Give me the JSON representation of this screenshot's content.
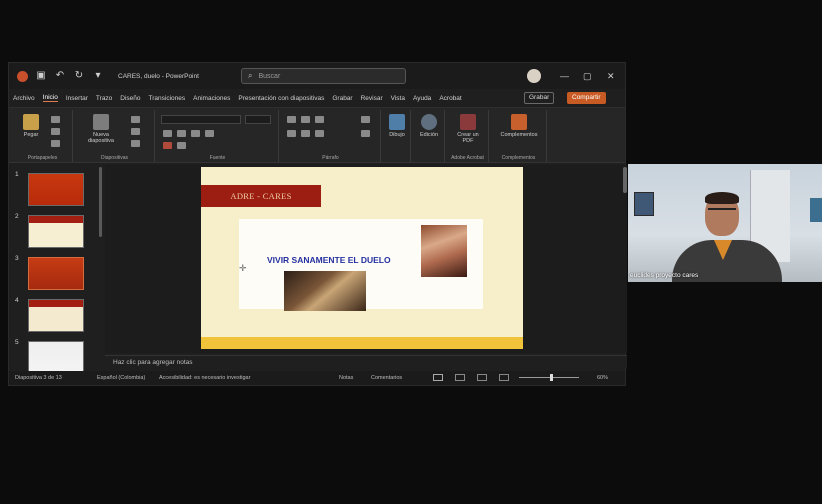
{
  "window": {
    "title": "CARES, duelo  -  PowerPoint",
    "search_placeholder": "Buscar",
    "minimize_glyph": "—",
    "maximize_glyph": "▢",
    "close_glyph": "✕"
  },
  "tabs": [
    {
      "label": "Archivo"
    },
    {
      "label": "Inicio"
    },
    {
      "label": "Insertar"
    },
    {
      "label": "Trazo"
    },
    {
      "label": "Diseño"
    },
    {
      "label": "Transiciones"
    },
    {
      "label": "Animaciones"
    },
    {
      "label": "Presentación con diapositivas"
    },
    {
      "label": "Grabar"
    },
    {
      "label": "Revisar"
    },
    {
      "label": "Vista"
    },
    {
      "label": "Ayuda"
    },
    {
      "label": "Acrobat"
    }
  ],
  "buttons": {
    "grabar": "Grabar",
    "compartir": "Compartir"
  },
  "ribbon": {
    "paste": "Pegar",
    "new_slide": "Nueva diapositiva",
    "draw": "Dibujo",
    "editing": "Edición",
    "create_pdf": "Crear un PDF",
    "addins": "Complementos",
    "groups": {
      "clipboard": "Portapapeles",
      "slides": "Diapositivas",
      "font": "Fuente",
      "paragraph": "Párrafo",
      "adobe": "Adobe Acrobat",
      "addins": "Complementos"
    }
  },
  "thumbnails": [
    {
      "num": "1"
    },
    {
      "num": "2"
    },
    {
      "num": "3"
    },
    {
      "num": "4"
    },
    {
      "num": "5"
    }
  ],
  "slide": {
    "title": "ADRE - CARES",
    "heading": "VIVIR SANAMENTE EL DUELO"
  },
  "notes_placeholder": "Haz clic para agregar notas",
  "status": {
    "slide_count": "Diapositiva 3 de 13",
    "language": "Español (Colombia)",
    "accessibility": "Accesibilidad: es necesario investigar",
    "notes": "Notas",
    "comments": "Comentarios",
    "zoom": "60%"
  },
  "participant": {
    "name": "euclides proyecto cares"
  },
  "colors": {
    "accent": "#c85a24",
    "slide_bg": "#f7efc9",
    "slide_title_bg": "#9c1e12",
    "heading": "#2530a0"
  }
}
